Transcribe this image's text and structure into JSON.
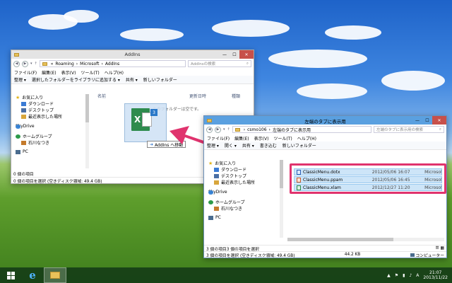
{
  "addins_window": {
    "title": "AddIns",
    "path": [
      "Roaming",
      "Microsoft",
      "AddIns"
    ],
    "search_placeholder": "AddInsの検索",
    "menu": [
      "ファイル(F)",
      "編集(E)",
      "表示(V)",
      "ツール(T)",
      "ヘルプ(H)"
    ],
    "toolbar": [
      "整理 ▾",
      "選択したフォルダーをライブラリに追加する ▾",
      "共有 ▾",
      "新しいフォルダー"
    ],
    "columns": [
      "名前",
      "更新日時",
      "種類"
    ],
    "empty_text": "このフォルダーは空です。",
    "drag_tooltip": "AddIns へ移動",
    "nav_items": [
      "お気に入り",
      "ダウンロード",
      "デスクトップ",
      "最近表示した場所",
      "SkyDrive",
      "ホームグループ",
      "石川なつき",
      "PC"
    ],
    "status": "0 個の項目",
    "status2": "0 個の項目を選択 (空きディスク領域: 49.4 GB)"
  },
  "classic_window": {
    "title": "左端のタブに表示用",
    "path": [
      "csmo106",
      "左端のタブに表示用"
    ],
    "search_placeholder": "左端のタブに表示用の検索",
    "menu": [
      "ファイル(F)",
      "編集(E)",
      "表示(V)",
      "ツール(T)",
      "ヘルプ(H)"
    ],
    "toolbar": [
      "整理 ▾",
      "開く ▾",
      "共有 ▾",
      "書き込む",
      "新しいフォルダー"
    ],
    "nav_items": [
      "お気に入り",
      "ダウンロード",
      "デスクトップ",
      "最近表示した場所",
      "SkyDrive",
      "ホームグループ",
      "石川なつき",
      "PC"
    ],
    "files": [
      {
        "name": "ClassicMenu.dotx",
        "date": "2012/05/06 16:07",
        "type": "Microsoft"
      },
      {
        "name": "ClassicMenu.ppam",
        "date": "2012/05/06 16:45",
        "type": "Microsoft"
      },
      {
        "name": "ClassicMenu.xlam",
        "date": "2012/12/27 11:20",
        "type": "Microsoft"
      }
    ],
    "status": "3 個の項目",
    "status_selected": "3 個の項目を選択",
    "status2": "3 個の項目を選択 (空きディスク領域: 49.4 GB)",
    "size": "44.2 KB",
    "location": "コンピューター"
  },
  "taskbar": {
    "time": "21:07",
    "date": "2013/11/22",
    "ime": "A"
  }
}
